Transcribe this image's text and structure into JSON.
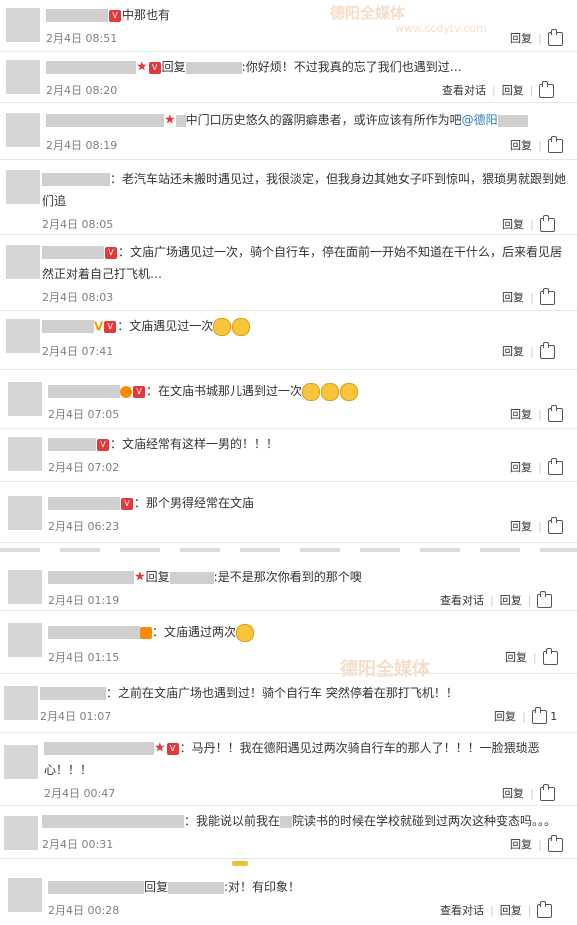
{
  "watermark": {
    "text": "德阳全媒体",
    "url": "www.scdytv.com"
  },
  "actions": {
    "reply": "回复",
    "view_conversation": "查看对话"
  },
  "comments": [
    {
      "prefix": "",
      "text": "中那也有",
      "time": "2月4日 08:51",
      "conv": false,
      "likes": ""
    },
    {
      "prefix": "回复",
      "text": ":你好烦！不过我真的忘了我们也遇到过…",
      "time": "2月4日 08:20",
      "conv": true,
      "likes": ""
    },
    {
      "prefix": "",
      "text": "中门口历史悠久的露阴癖患者，或许应该有所作为吧",
      "mention": "@德阳",
      "time": "2月4日 08:19",
      "conv": false,
      "likes": ""
    },
    {
      "prefix": "",
      "text": "：老汽车站还未搬时遇见过，我很淡定，但我身边其她女子吓到惊叫，猥琐男就跟到她",
      "text2": "们追",
      "time": "2月4日 08:05",
      "conv": false,
      "likes": ""
    },
    {
      "prefix": "",
      "text": "：文庙广场遇见过一次，骑个自行车，停在面前一开始不知道在干什么，后来看见居",
      "text2": "然正对着自己打飞机…",
      "time": "2月4日 08:03",
      "conv": false,
      "likes": ""
    },
    {
      "prefix": "",
      "text": "：文庙遇见过一次",
      "time": "2月4日 07:41",
      "conv": false,
      "likes": ""
    },
    {
      "prefix": "",
      "text": "：在文庙书城那儿遇到过一次",
      "time": "2月4日 07:05",
      "conv": false,
      "likes": ""
    },
    {
      "prefix": "",
      "text": "：文庙经常有这样一男的！！！",
      "time": "2月4日 07:02",
      "conv": false,
      "likes": ""
    },
    {
      "prefix": "",
      "text": "：那个男得经常在文庙",
      "time": "2月4日 06:23",
      "conv": false,
      "likes": ""
    },
    {
      "prefix": "回复",
      "text": ":是不是那次你看到的那个噢",
      "time": "2月4日 01:19",
      "conv": true,
      "likes": ""
    },
    {
      "prefix": "",
      "text": "：文庙遇过两次",
      "time": "2月4日 01:15",
      "conv": false,
      "likes": ""
    },
    {
      "prefix": "",
      "text": "：之前在文庙广场也遇到过！骑个自行车 突然停着在那打飞机！！",
      "time": "2月4日 01:07",
      "conv": false,
      "likes": "1"
    },
    {
      "prefix": "",
      "text": "：马丹！！我在德阳遇见过两次骑自行车的那人了！！！一脸猥琐恶",
      "text2": "心！！！",
      "time": "2月4日 00:47",
      "conv": false,
      "likes": ""
    },
    {
      "prefix": "",
      "text": "：我能说以前我在",
      "text_b": "院读书的时候在学校就碰到过两次这种变态吗。。。",
      "time": "2月4日 00:31",
      "conv": false,
      "likes": ""
    },
    {
      "prefix": "回复",
      "text": ":对！有印象！",
      "time": "2月4日 00:28",
      "conv": true,
      "likes": ""
    }
  ]
}
